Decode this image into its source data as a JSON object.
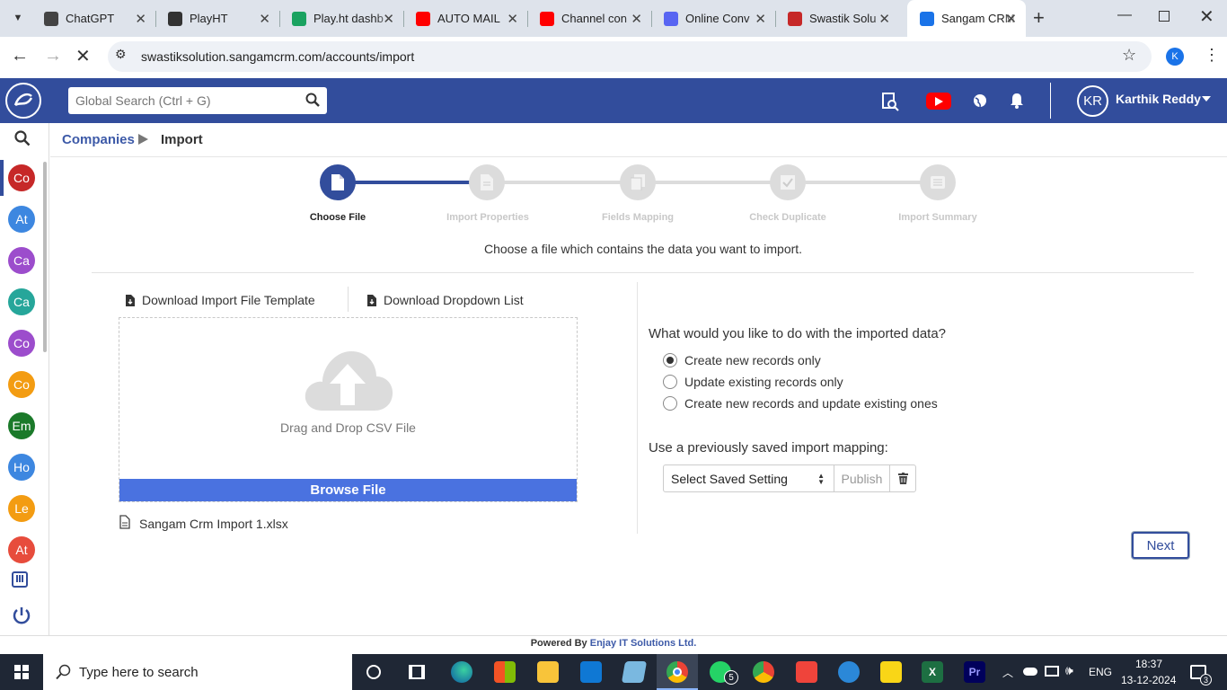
{
  "browser": {
    "tabs": [
      {
        "title": "ChatGPT",
        "color": "#444444"
      },
      {
        "title": "PlayHT",
        "color": "#333333"
      },
      {
        "title": "Play.ht dashb",
        "color": "#1aa260"
      },
      {
        "title": "AUTO MAIL",
        "color": "#ff0000"
      },
      {
        "title": "Channel con",
        "color": "#ff0000"
      },
      {
        "title": "Online Conv",
        "color": "#5865f2"
      },
      {
        "title": "Swastik Solu",
        "color": "#c62828"
      },
      {
        "title": "Sangam CRM",
        "color": "#1a73e8"
      }
    ],
    "url": "swastiksolution.sangamcrm.com/accounts/import",
    "profile_initial": "K"
  },
  "header": {
    "search_placeholder": "Global Search (Ctrl + G)",
    "user_initials": "KR",
    "user_name": "Karthik Reddy",
    "brand_color": "#324d9c"
  },
  "sidebar": {
    "modules": [
      {
        "label": "Co",
        "color": "#c62828"
      },
      {
        "label": "At",
        "color": "#3d87e0"
      },
      {
        "label": "Ca",
        "color": "#9c4dcc"
      },
      {
        "label": "Ca",
        "color": "#26a69a"
      },
      {
        "label": "Co",
        "color": "#9c4dcc"
      },
      {
        "label": "Co",
        "color": "#f39c12"
      },
      {
        "label": "Em",
        "color": "#1b7a2a"
      },
      {
        "label": "Ho",
        "color": "#3d87e0"
      },
      {
        "label": "Le",
        "color": "#f39c12"
      },
      {
        "label": "At",
        "color": "#e74c3c"
      }
    ]
  },
  "breadcrumb": {
    "parent": "Companies",
    "current": "Import"
  },
  "wizard": {
    "steps": [
      "Choose File",
      "Import Properties",
      "Fields Mapping",
      "Check Duplicate",
      "Import Summary"
    ],
    "active_step": 0,
    "instruction": "Choose a file which contains the data you want to import."
  },
  "upload": {
    "download_template": "Download Import File Template",
    "download_dropdown": "Download Dropdown List",
    "drop_text": "Drag and Drop CSV File",
    "browse_label": "Browse File",
    "selected_file": "Sangam Crm Import 1.xlsx"
  },
  "options": {
    "question": "What would you like to do with the imported data?",
    "choices": [
      "Create new records only",
      "Update existing records only",
      "Create new records and update existing ones"
    ],
    "selected": 0,
    "mapping_label": "Use a previously saved import mapping:",
    "select_value": "Select Saved Setting",
    "publish_label": "Publish",
    "next_label": "Next"
  },
  "footer": {
    "powered_prefix": "Powered By",
    "company": "Enjay IT Solutions Ltd."
  },
  "taskbar": {
    "search_placeholder": "Type here to search",
    "whatsapp_badge": "5",
    "language": "ENG",
    "time": "18:37",
    "date": "13-12-2024",
    "notif_count": "3"
  }
}
